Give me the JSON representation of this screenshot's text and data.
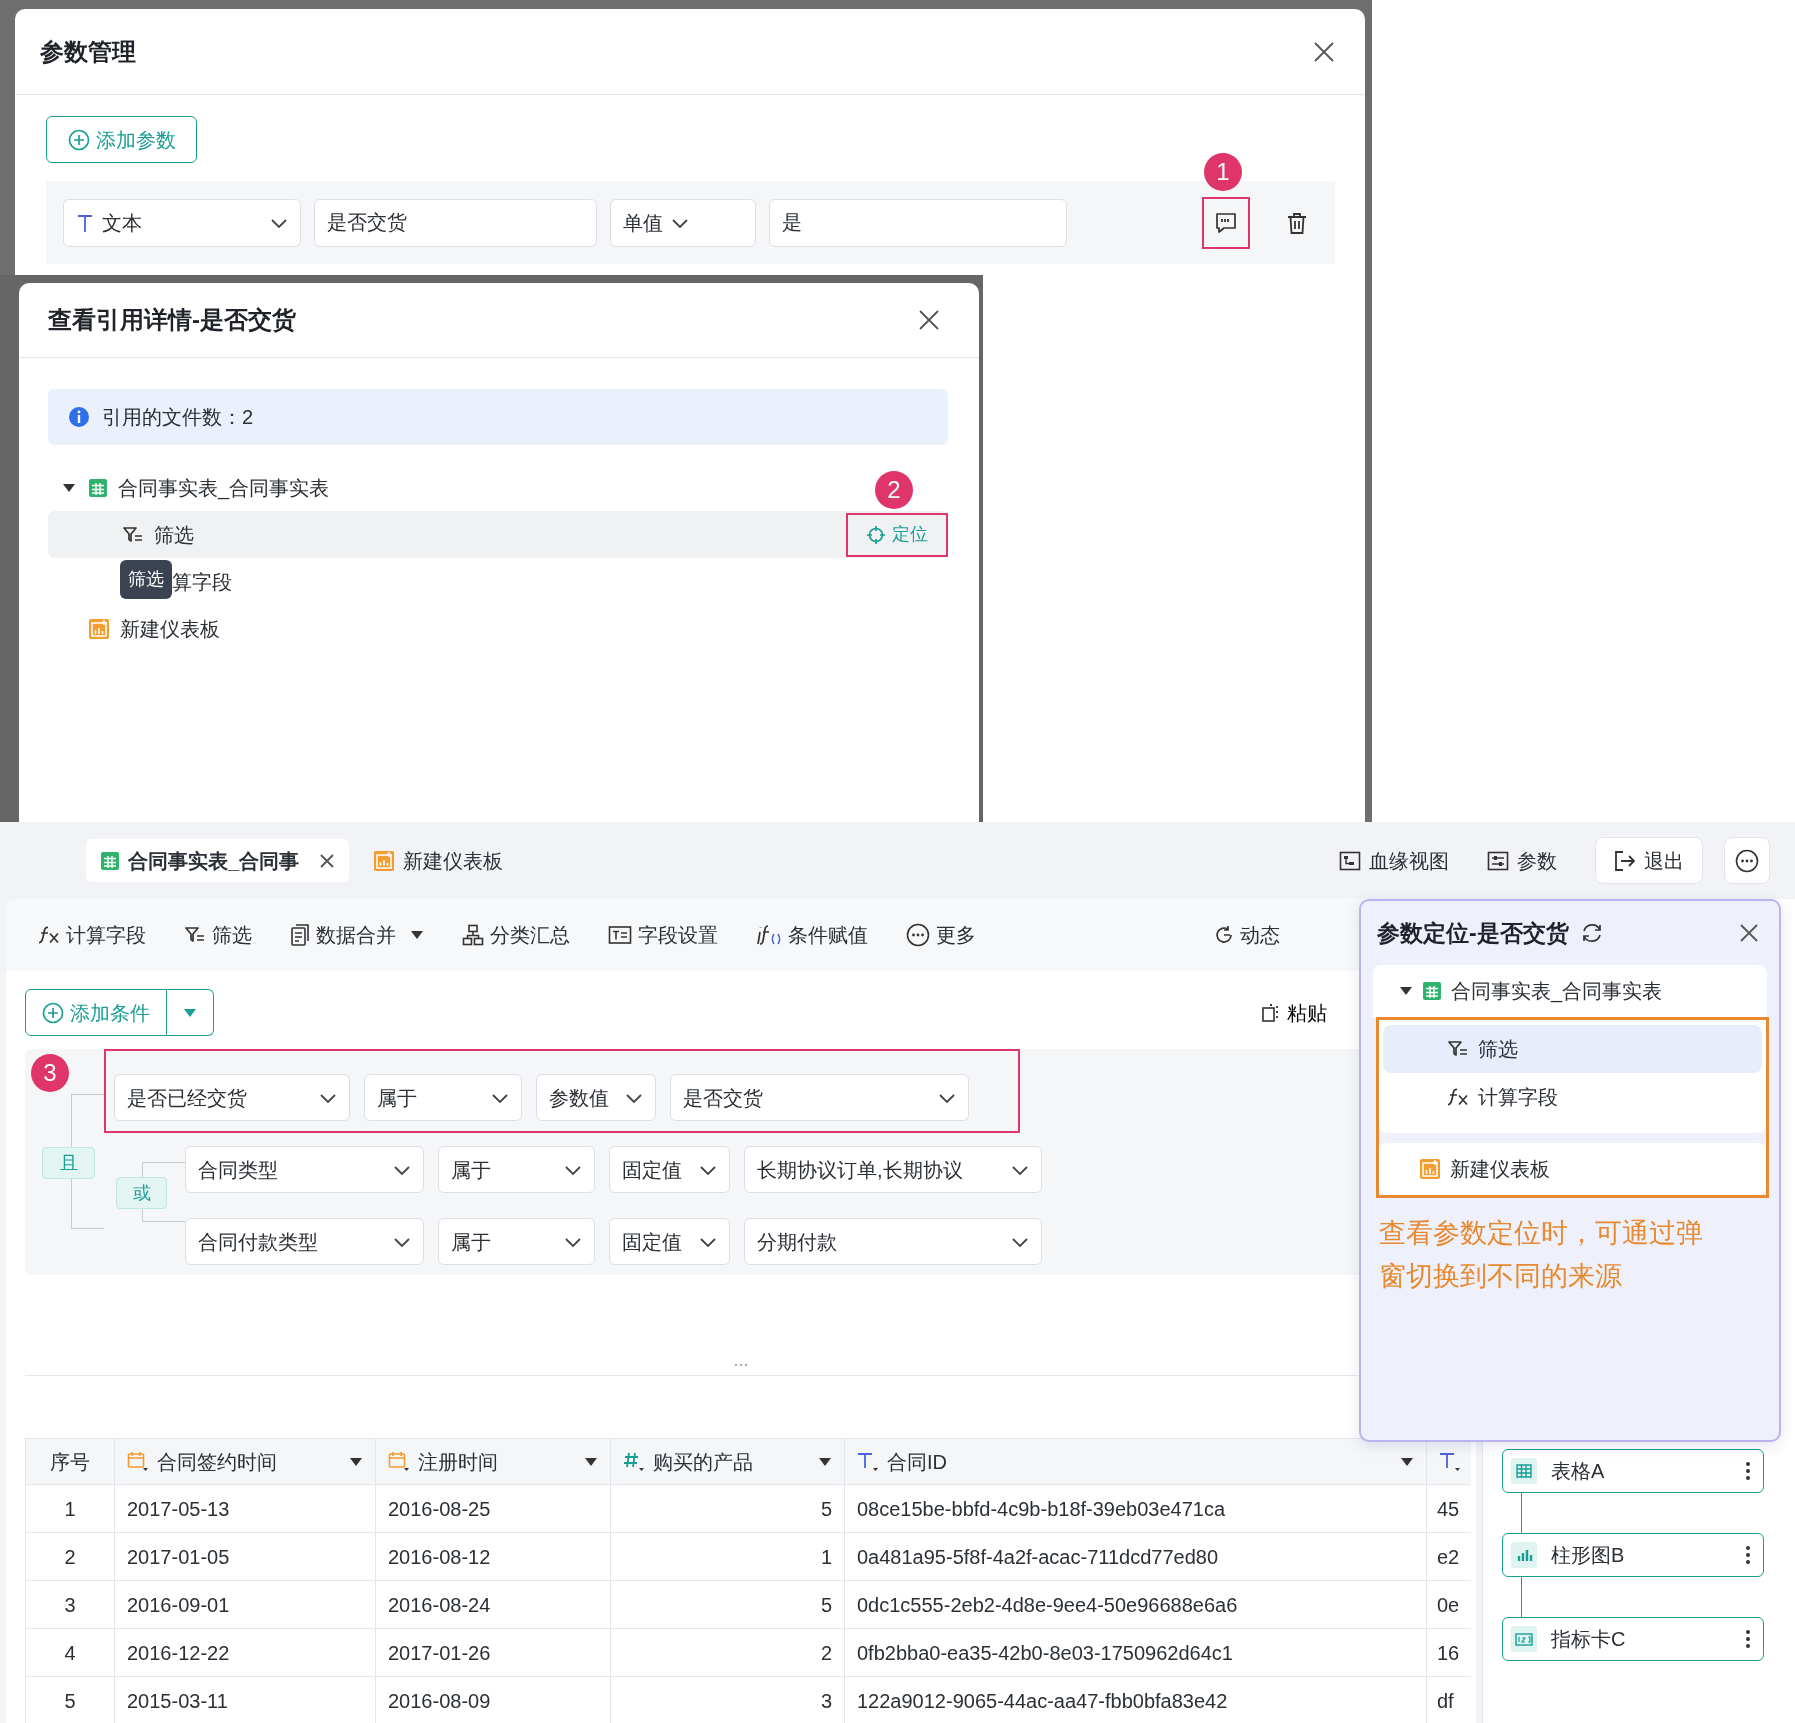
{
  "param_dialog": {
    "title": "参数管理",
    "add_button": "添加参数",
    "params": [
      {
        "type": "文本",
        "name": "是否交货",
        "mode": "单值",
        "value": "是",
        "highlighted": true,
        "badge": "1"
      }
    ]
  },
  "reference_dialog": {
    "title": "查看引用详情-是否交货",
    "info": "引用的文件数：2",
    "tree": [
      {
        "label": "合同事实表_合同事实表",
        "kind": "table",
        "selected": false,
        "expanded": true,
        "children": [
          {
            "label": "筛选",
            "kind": "filter",
            "selected": true,
            "locate_button": "定位",
            "highlighted": true,
            "badge": "2"
          },
          {
            "label": "算字段",
            "kind": "covered",
            "selected": false,
            "tooltip": "筛选"
          }
        ]
      },
      {
        "label": "新建仪表板",
        "kind": "dashboard",
        "selected": false
      }
    ]
  },
  "app": {
    "tabs": [
      {
        "label": "合同事实表_合同事",
        "kind": "table",
        "selected": true,
        "closable": true
      },
      {
        "label": "新建仪表板",
        "kind": "dashboard",
        "selected": false
      }
    ],
    "actions": [
      {
        "label": "血缘视图",
        "kind": "lineage"
      },
      {
        "label": "参数",
        "kind": "param"
      },
      {
        "label": "退出",
        "kind": "exit"
      },
      {
        "kind": "more"
      }
    ],
    "toolbar": [
      {
        "label": "计算字段",
        "kind": "formula"
      },
      {
        "label": "筛选",
        "kind": "filter"
      },
      {
        "label": "数据合并",
        "kind": "merge",
        "dropdown": true
      },
      {
        "label": "分类汇总",
        "kind": "group"
      },
      {
        "label": "字段设置",
        "kind": "fields"
      },
      {
        "label": "条件赋值",
        "kind": "if"
      },
      {
        "label": "更多",
        "kind": "more"
      },
      {
        "label": "动态",
        "kind": "dynamic"
      }
    ],
    "add_condition": "添加条件",
    "paste": "粘贴",
    "conditions": {
      "logic": "且",
      "items": [
        {
          "kind": "condition",
          "field": "是否已经交货",
          "operator": "属于",
          "value_type": "参数值",
          "value": "是否交货",
          "highlighted": true,
          "badge": "3"
        },
        {
          "kind": "group",
          "logic": "或",
          "items": [
            {
              "kind": "condition",
              "field": "合同类型",
              "operator": "属于",
              "value_type": "固定值",
              "value": "长期协议订单,长期协议"
            },
            {
              "kind": "condition",
              "field": "合同付款类型",
              "operator": "属于",
              "value_type": "固定值",
              "value": "分期付款"
            }
          ]
        }
      ]
    },
    "table": {
      "columns": [
        {
          "label": "序号",
          "kind": "index"
        },
        {
          "label": "合同签约时间",
          "kind": "date",
          "menu": true
        },
        {
          "label": "注册时间",
          "kind": "date",
          "menu": true
        },
        {
          "label": "购买的产品",
          "kind": "number",
          "menu": true
        },
        {
          "label": "合同ID",
          "kind": "text",
          "menu": true
        },
        {
          "kind": "text"
        }
      ],
      "rows": [
        [
          "1",
          "2017-05-13",
          "2016-08-25",
          "5",
          "08ce15be-bbfd-4c9b-b18f-39eb03e471ca",
          "45"
        ],
        [
          "2",
          "2017-01-05",
          "2016-08-12",
          "1",
          "0a481a95-5f8f-4a2f-acac-711dcd77ed80",
          "e2"
        ],
        [
          "3",
          "2016-09-01",
          "2016-08-24",
          "5",
          "0dc1c555-2eb2-4d8e-9ee4-50e96688e6a6",
          "0e"
        ],
        [
          "4",
          "2016-12-22",
          "2017-01-26",
          "2",
          "0fb2bba0-ea35-42b0-8e03-1750962d64c1",
          "16"
        ],
        [
          "5",
          "2015-03-11",
          "2016-08-09",
          "3",
          "122a9012-9065-44ac-aa47-fbb0bfa83e42",
          "df"
        ]
      ]
    },
    "lineage": [
      {
        "label": "表格A",
        "kind": "table"
      },
      {
        "label": "柱形图B",
        "kind": "bar"
      },
      {
        "label": "指标卡C",
        "kind": "kpi"
      }
    ]
  },
  "locate_panel": {
    "title": "参数定位-是否交货",
    "tree": [
      {
        "label": "合同事实表_合同事实表",
        "kind": "table",
        "selected": false,
        "expanded": true,
        "children": [
          {
            "label": "筛选",
            "kind": "filter",
            "selected": true,
            "framed": true
          },
          {
            "label": "计算字段",
            "kind": "formula",
            "selected": false,
            "framed": true
          }
        ]
      },
      {
        "label": "新建仪表板",
        "kind": "dashboard",
        "selected": false,
        "framed": true
      }
    ],
    "note": "查看参数定位时，可通过弹窗切换到不同的来源"
  }
}
